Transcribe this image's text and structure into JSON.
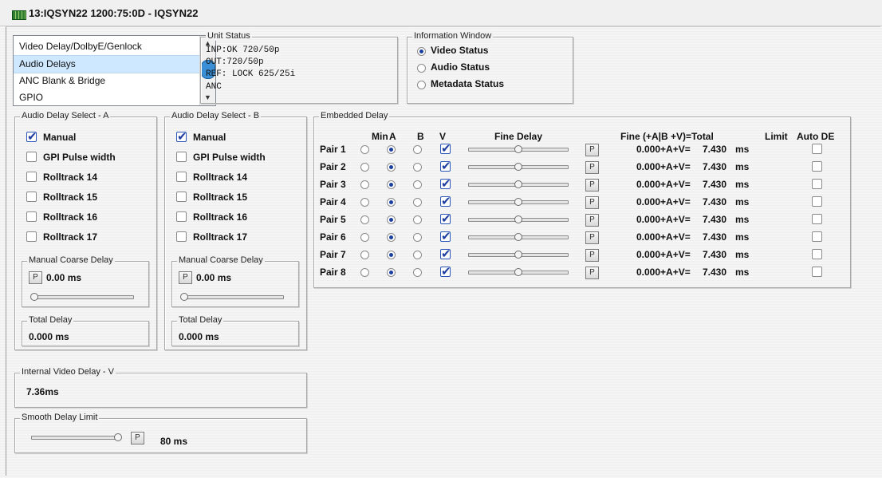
{
  "window": {
    "title": "13:IQSYN22  1200:75:0D  - IQSYN22"
  },
  "menu_list": {
    "items": [
      "Video Delay/DolbyE/Genlock",
      "Audio Delays",
      "ANC Blank & Bridge",
      "GPIO"
    ],
    "selected_index": 1
  },
  "unit_status": {
    "title": "Unit Status",
    "lines": [
      "INP:OK    720/50p",
      "OUT:720/50p",
      "REF: LOCK 625/25i",
      "ANC"
    ]
  },
  "info_window": {
    "title": "Information Window",
    "options": [
      "Video Status",
      "Audio Status",
      "Metadata Status"
    ],
    "selected_index": 0
  },
  "delay_select_a": {
    "title": "Audio Delay Select - A",
    "options": [
      {
        "label": "Manual",
        "checked": true
      },
      {
        "label": "GPI Pulse width",
        "checked": false
      },
      {
        "label": "Rolltrack 14",
        "checked": false
      },
      {
        "label": "Rolltrack 15",
        "checked": false
      },
      {
        "label": "Rolltrack 16",
        "checked": false
      },
      {
        "label": "Rolltrack 17",
        "checked": false
      }
    ],
    "coarse_title": "Manual Coarse Delay",
    "p_label": "P",
    "coarse_value": "0.00 ms",
    "total_title": "Total Delay",
    "total_value": "0.000 ms"
  },
  "delay_select_b": {
    "title": "Audio Delay Select - B",
    "options": [
      {
        "label": "Manual",
        "checked": true
      },
      {
        "label": "GPI Pulse width",
        "checked": false
      },
      {
        "label": "Rolltrack 14",
        "checked": false
      },
      {
        "label": "Rolltrack 15",
        "checked": false
      },
      {
        "label": "Rolltrack 16",
        "checked": false
      },
      {
        "label": "Rolltrack 17",
        "checked": false
      }
    ],
    "coarse_title": "Manual Coarse Delay",
    "p_label": "P",
    "coarse_value": "0.00 ms",
    "total_title": "Total Delay",
    "total_value": "0.000 ms"
  },
  "internal_video": {
    "title": "Internal Video Delay - V",
    "value": "7.36ms"
  },
  "smooth_limit": {
    "title": "Smooth Delay Limit",
    "p_label": "P",
    "value": "80 ms"
  },
  "embedded": {
    "title": "Embedded Delay",
    "headers": {
      "min": "Min",
      "a": "A",
      "b": "B",
      "v": "V",
      "fine": "Fine Delay",
      "total": "Fine (+A|B +V)=Total",
      "limit": "Limit",
      "autode": "Auto DE"
    },
    "rows": [
      {
        "label": "Pair 1",
        "formula": "0.000+A+V=",
        "value": "7.430",
        "unit": "ms"
      },
      {
        "label": "Pair 2",
        "formula": "0.000+A+V=",
        "value": "7.430",
        "unit": "ms"
      },
      {
        "label": "Pair 3",
        "formula": "0.000+A+V=",
        "value": "7.430",
        "unit": "ms"
      },
      {
        "label": "Pair 4",
        "formula": "0.000+A+V=",
        "value": "7.430",
        "unit": "ms"
      },
      {
        "label": "Pair 5",
        "formula": "0.000+A+V=",
        "value": "7.430",
        "unit": "ms"
      },
      {
        "label": "Pair 6",
        "formula": "0.000+A+V=",
        "value": "7.430",
        "unit": "ms"
      },
      {
        "label": "Pair 7",
        "formula": "0.000+A+V=",
        "value": "7.430",
        "unit": "ms"
      },
      {
        "label": "Pair 8",
        "formula": "0.000+A+V=",
        "value": "7.430",
        "unit": "ms"
      }
    ],
    "selected_source": "A",
    "v_checked": true,
    "p_label": "P"
  }
}
